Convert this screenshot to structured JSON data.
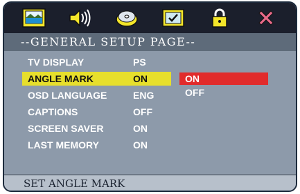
{
  "toolbar": {
    "icons": [
      "display-icon",
      "speaker-icon",
      "disc-icon",
      "checkbox-icon",
      "lock-icon",
      "close-icon"
    ],
    "colors": {
      "accent_yellow": "#f4e62a",
      "close_pink": "#e86a8a"
    }
  },
  "header": {
    "title": "--GENERAL SETUP PAGE--"
  },
  "settings": [
    {
      "label": "TV DISPLAY",
      "value": "PS"
    },
    {
      "label": "ANGLE MARK",
      "value": "ON"
    },
    {
      "label": "OSD LANGUAGE",
      "value": "ENG"
    },
    {
      "label": "CAPTIONS",
      "value": "OFF"
    },
    {
      "label": "SCREEN SAVER",
      "value": "ON"
    },
    {
      "label": "LAST MEMORY",
      "value": "ON"
    }
  ],
  "options": [
    {
      "label": "ON"
    },
    {
      "label": "OFF"
    }
  ],
  "footer": {
    "status": "SET ANGLE MARK"
  },
  "colors": {
    "background": "#8d9aaa",
    "selected_row": "#e7df2c",
    "highlight_option": "#e12b2b"
  }
}
